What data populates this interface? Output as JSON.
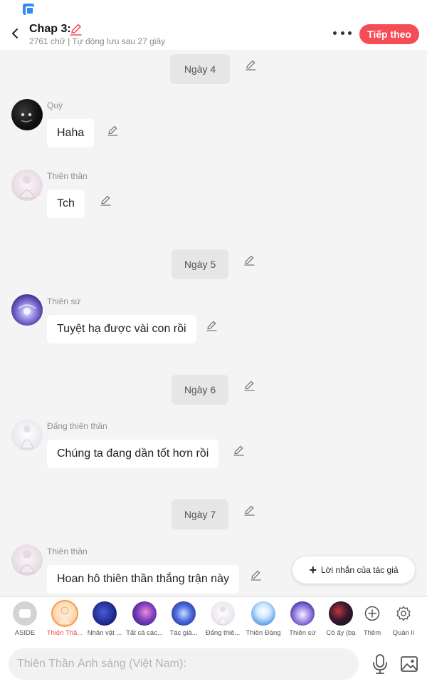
{
  "header": {
    "title": "Chap 3:",
    "subtitle": "2761 chữ | Tự động lưu sau 27 giây",
    "next_label": "Tiếp theo"
  },
  "messages": [
    {
      "type": "day",
      "label": "Ngày 4"
    },
    {
      "type": "msg",
      "sender": "Quý",
      "text": "Haha"
    },
    {
      "type": "msg",
      "sender": "Thiên thần",
      "text": "Tch"
    },
    {
      "type": "day",
      "label": "Ngày 5"
    },
    {
      "type": "msg",
      "sender": "Thiên sứ",
      "text": "Tuyệt hạ được vài con rồi"
    },
    {
      "type": "day",
      "label": "Ngày 6"
    },
    {
      "type": "msg",
      "sender": "Đấng thiên thần",
      "text": "Chúng ta đang dần tốt hơn rồi"
    },
    {
      "type": "day",
      "label": "Ngày 7"
    },
    {
      "type": "msg",
      "sender": "Thiên thần",
      "text": "Hoan hô thiên thần thắng trận này"
    }
  ],
  "author_note": {
    "label": "Lời nhắn của tác giả"
  },
  "characters": [
    {
      "label": "ASIDE",
      "active": false
    },
    {
      "label": "Thiên Thầ...",
      "active": true
    },
    {
      "label": "Nhân vật ...",
      "active": false
    },
    {
      "label": "Tất cả các...",
      "active": false
    },
    {
      "label": "Tác giả...",
      "active": false
    },
    {
      "label": "Đấng thiê...",
      "active": false
    },
    {
      "label": "Thiên Đàng",
      "active": false
    },
    {
      "label": "Thiên sứ",
      "active": false
    },
    {
      "label": "Cô ấy (bạ",
      "active": false
    }
  ],
  "tools": {
    "add_label": "Thêm",
    "manage_label": "Quản lí"
  },
  "input": {
    "placeholder": "Thiên Thần Ánh sáng (Việt Nam):",
    "value": ""
  },
  "colors": {
    "accent": "#f64c55",
    "background": "#f4f4f4",
    "bubble": "#ffffff"
  },
  "icons": [
    "back-icon",
    "pencil-icon",
    "more-icon",
    "plus-icon",
    "add-circle-icon",
    "gear-icon",
    "microphone-icon",
    "image-icon"
  ]
}
